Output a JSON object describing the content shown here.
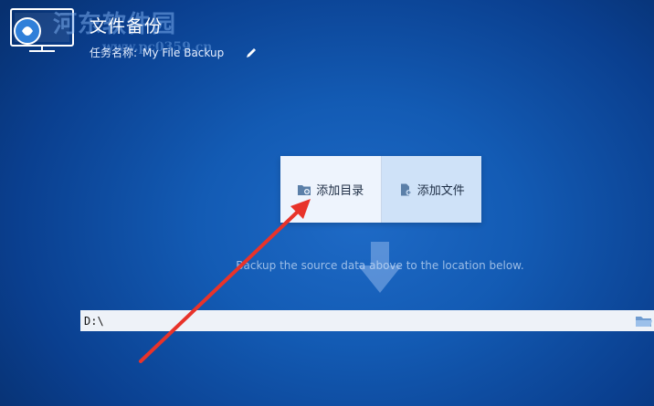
{
  "header": {
    "title": "文件备份",
    "task_label": "任务名称:",
    "task_name": "My File Backup"
  },
  "watermark": {
    "text": "河东软件园",
    "url": "www.pc0359.cn"
  },
  "source": {
    "add_directory_label": "添加目录",
    "add_file_label": "添加文件",
    "hint": "Backup the source data above to the location below."
  },
  "destination": {
    "path": "D:\\"
  },
  "icons": {
    "logo": "monitor-icon",
    "edit": "pencil-icon",
    "add_directory": "folder-add-icon",
    "add_file": "file-add-icon",
    "arrow": "down-arrow-icon",
    "browse": "folder-icon"
  },
  "colors": {
    "background": "#135bb4",
    "panel": "#eef4fd",
    "panel_active": "#cfe2f8",
    "annotation_arrow": "#e8332a"
  }
}
